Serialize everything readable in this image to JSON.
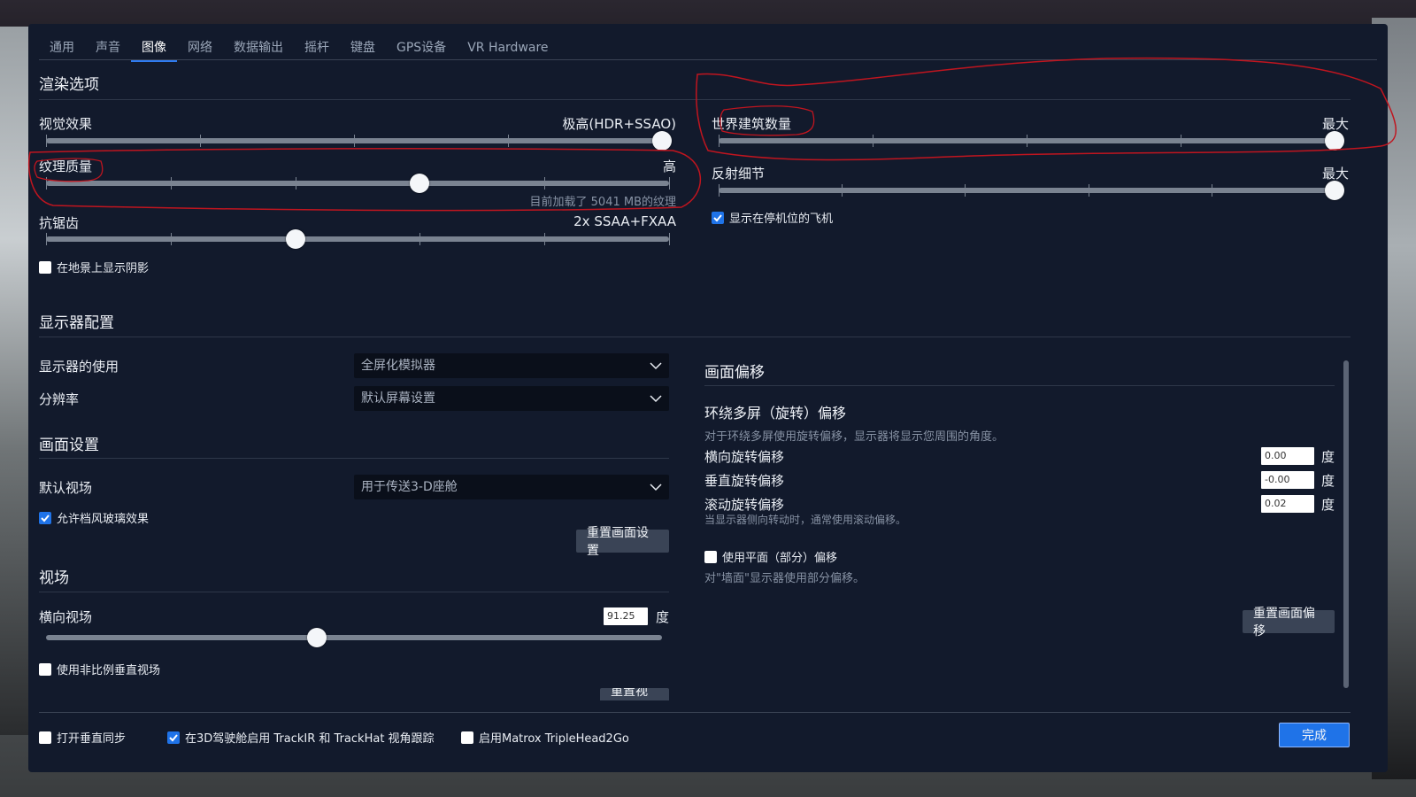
{
  "tabs": [
    "通用",
    "声音",
    "图像",
    "网络",
    "数据输出",
    "摇杆",
    "键盘",
    "GPS设备",
    "VR Hardware"
  ],
  "active_tab": 2,
  "render": {
    "title": "渲染选项",
    "visual_effects": {
      "label": "视觉效果",
      "value": "极高(HDR+SSAO)",
      "level": 1.0
    },
    "texture_quality": {
      "label": "纹理质量",
      "value": "高",
      "level": 0.6,
      "hint": "目前加载了 5041 MB的纹理"
    },
    "antialiasing": {
      "label": "抗锯齿",
      "value": "2x SSAA+FXAA",
      "level": 0.4
    },
    "show_terrain_shadows": {
      "label": "在地景上显示阴影",
      "checked": false
    },
    "world_objects": {
      "label": "世界建筑数量",
      "value": "最大",
      "level": 1.0
    },
    "reflection_detail": {
      "label": "反射细节",
      "value": "最大",
      "level": 1.0
    },
    "show_parked_aircraft": {
      "label": "显示在停机位的飞机",
      "checked": true
    }
  },
  "monitor": {
    "title": "显示器配置",
    "usage": {
      "label": "显示器的使用",
      "value": "全屏化模拟器"
    },
    "resolution": {
      "label": "分辨率",
      "value": "默认屏幕设置"
    }
  },
  "view": {
    "title": "画面设置",
    "default_view": {
      "label": "默认视场",
      "value": "用于传送3-D座舱"
    },
    "windshield": {
      "label": "允许档风玻璃效果",
      "checked": true
    },
    "reset_button": "重置画面设置"
  },
  "fov": {
    "title": "视场",
    "horizontal": {
      "label": "横向视场",
      "value": "91.25",
      "unit": "度",
      "level": 0.44
    },
    "non_proportional": {
      "label": "使用非比例垂直视场",
      "checked": false
    },
    "reset_button": "重置视场"
  },
  "offset": {
    "title": "画面偏移",
    "surround_title": "环绕多屏（旋转）偏移",
    "surround_desc": "对于环绕多屏使用旋转偏移，显示器将显示您周围的角度。",
    "lateral": {
      "label": "横向旋转偏移",
      "value": "0.00",
      "unit": "度"
    },
    "vertical": {
      "label": "垂直旋转偏移",
      "value": "-0.00",
      "unit": "度"
    },
    "roll": {
      "label": "滚动旋转偏移",
      "value": "0.02",
      "unit": "度",
      "hint": "当显示器侧向转动时，通常使用滚动偏移。"
    },
    "flat": {
      "label": "使用平面（部分）偏移",
      "checked": false
    },
    "flat_desc": "对\"墙面\"显示器使用部分偏移。",
    "reset_button": "重置画面偏移"
  },
  "footer": {
    "vsync": {
      "label": "打开垂直同步",
      "checked": false
    },
    "trackir": {
      "label": "在3D驾驶舱启用 TrackIR 和 TrackHat 视角跟踪",
      "checked": true
    },
    "matrox": {
      "label": "启用Matrox TripleHead2Go",
      "checked": false
    },
    "done": "完成"
  },
  "colors": {
    "panel": "#121a2c",
    "accent": "#1f73e8",
    "annotation": "#c0151f"
  }
}
